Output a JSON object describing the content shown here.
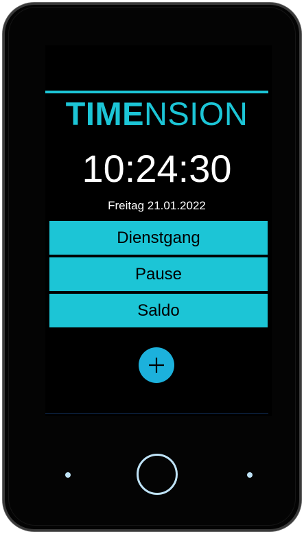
{
  "app": {
    "brand_bold": "TIME",
    "brand_rest": "NSION"
  },
  "status": {
    "time": "10:24:30",
    "date": "Freitag 21.01.2022"
  },
  "menu": {
    "items": [
      {
        "label": "Dienstgang"
      },
      {
        "label": "Pause"
      },
      {
        "label": "Saldo"
      }
    ]
  },
  "actions": {
    "add_icon": "plus-icon"
  },
  "device": {
    "nav_icons": [
      "dot-icon",
      "home-button",
      "dot-icon"
    ]
  },
  "colors": {
    "accent": "#1cc5d6",
    "add_button": "#1cb1dc",
    "screen_bg": "#000000",
    "clock_text": "#ffffff",
    "hardware_buttons": "#bfe3f7"
  }
}
